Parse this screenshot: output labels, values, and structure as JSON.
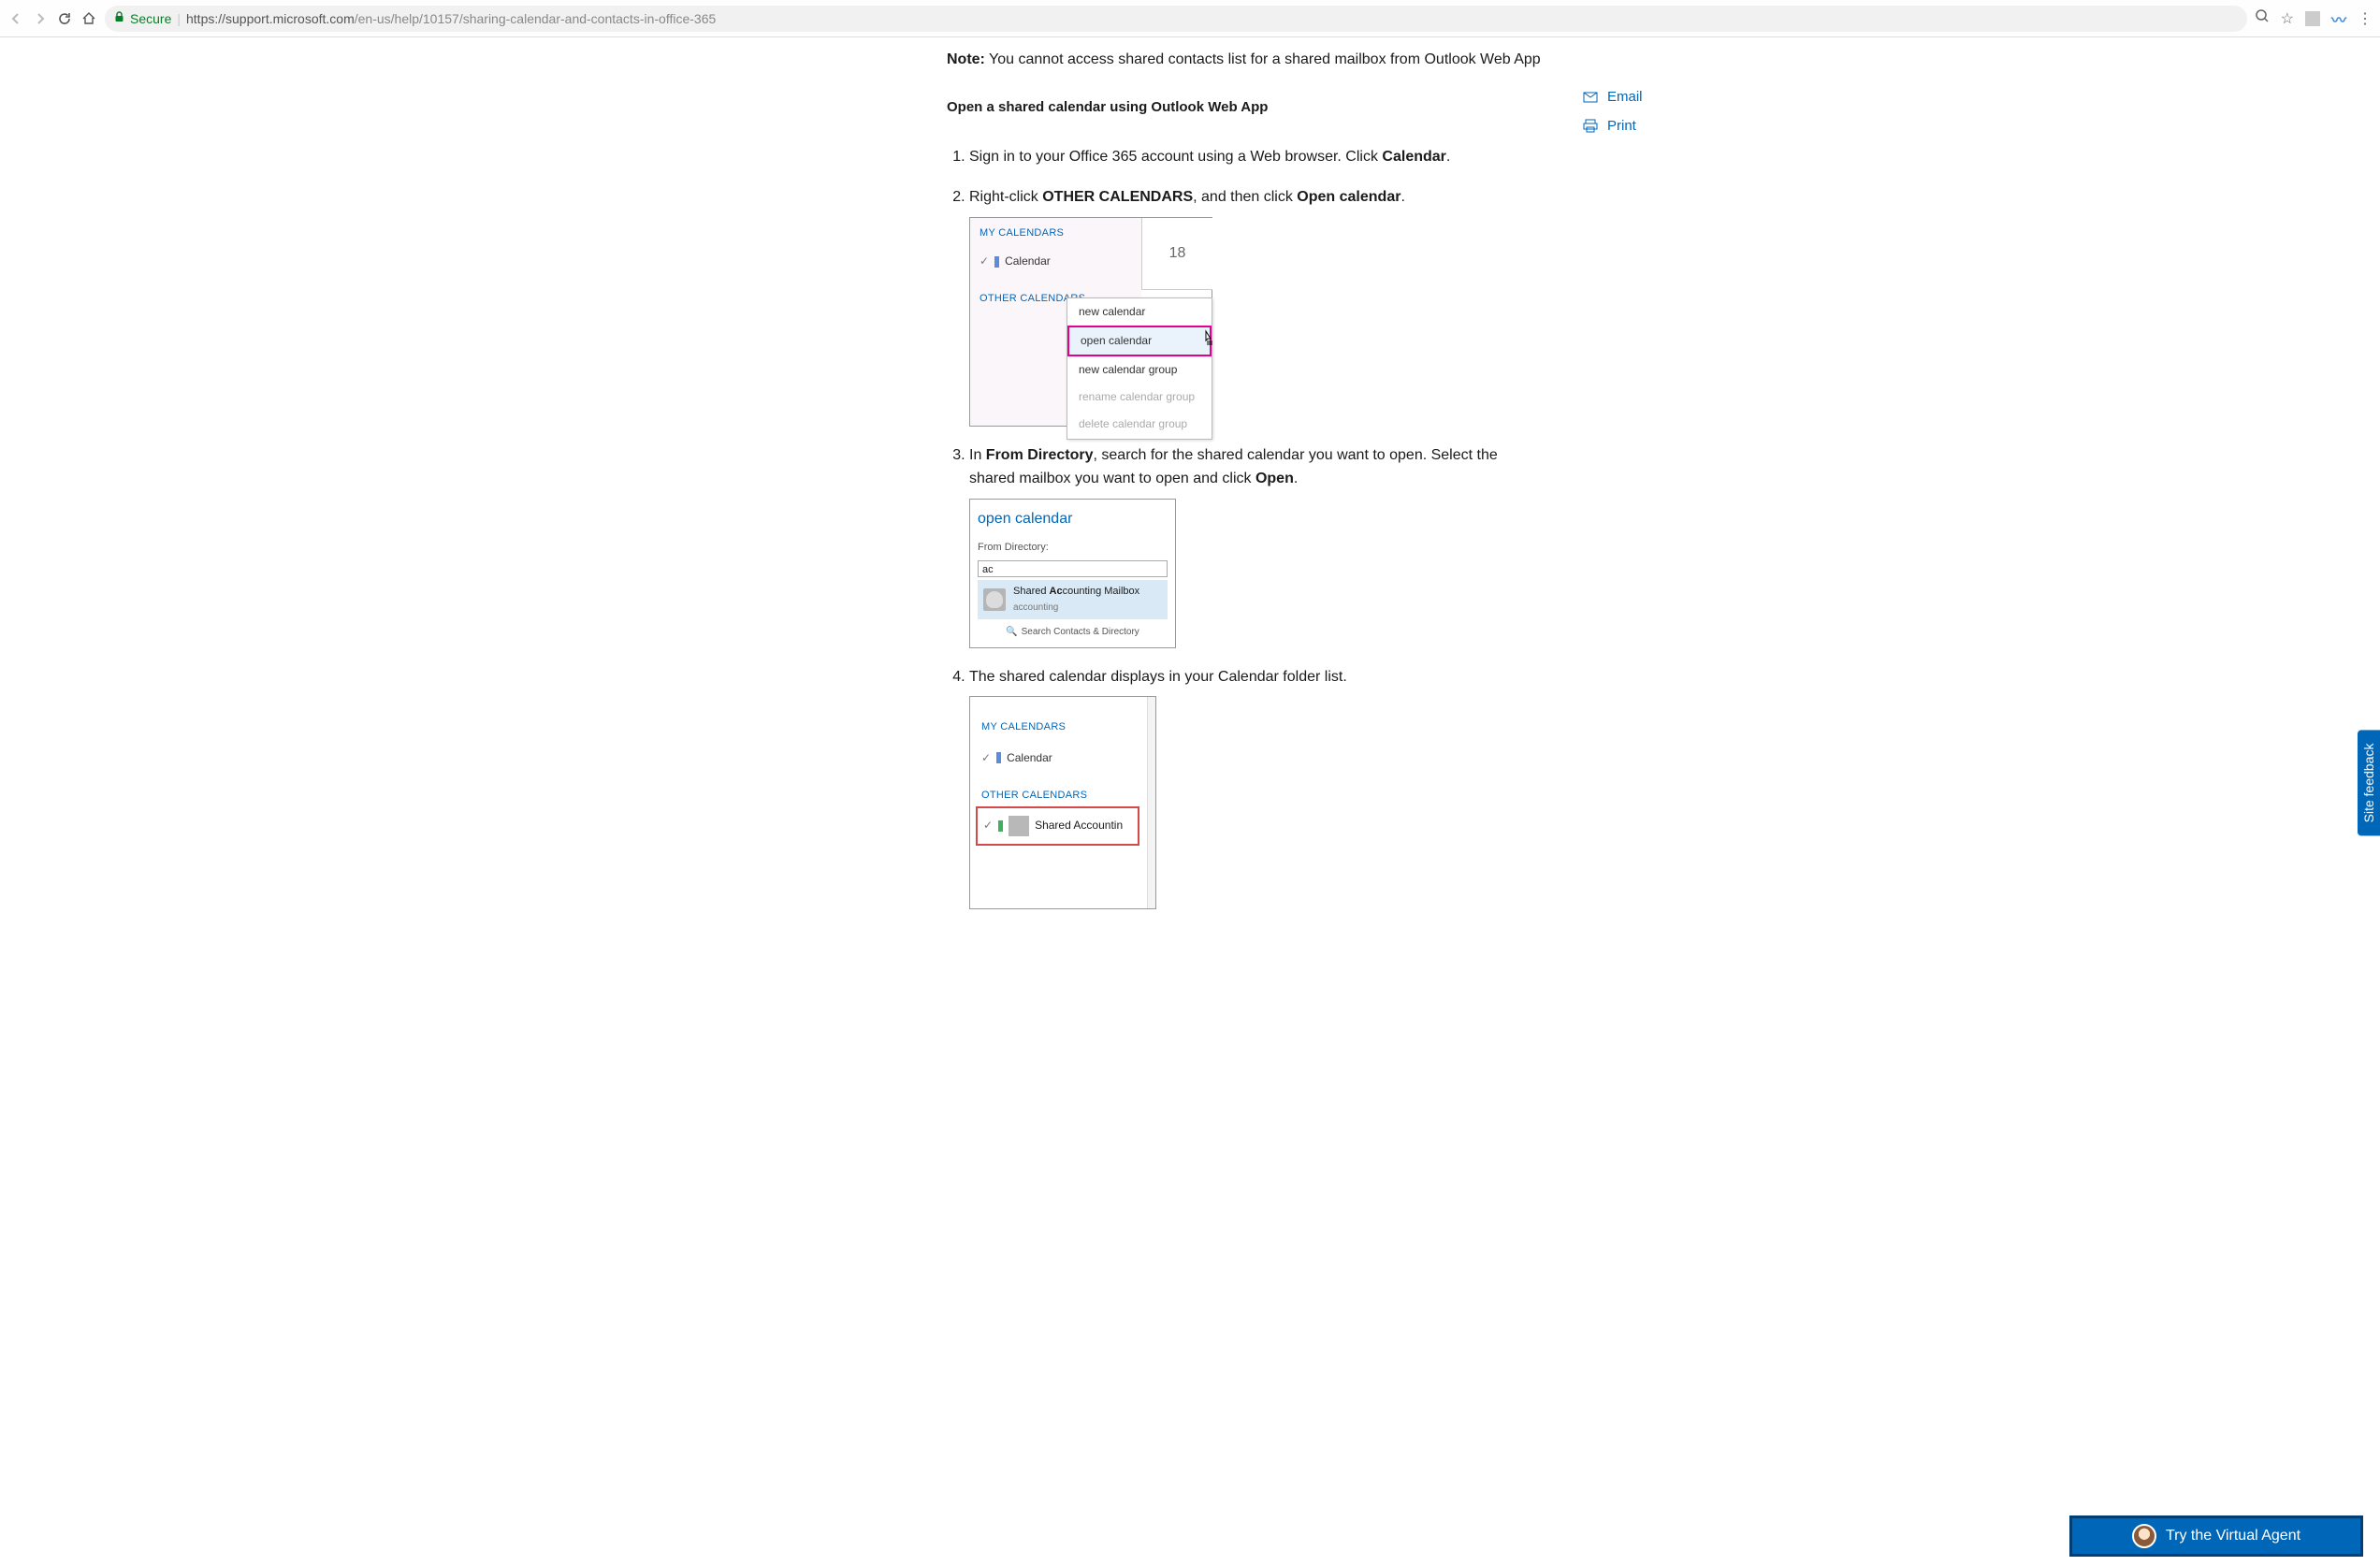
{
  "browser": {
    "secure_label": "Secure",
    "url_host": "https://support.microsoft.com",
    "url_path": "/en-us/help/10157/sharing-calendar-and-contacts-in-office-365"
  },
  "note": {
    "label": "Note:",
    "text": " You cannot access shared contacts list for a shared mailbox from Outlook Web App"
  },
  "section_heading": "Open a shared calendar using Outlook Web App",
  "steps": {
    "s1_a": "Sign in to your Office 365 account using a Web browser. Click ",
    "s1_b": "Calendar",
    "s1_c": ".",
    "s2_a": "Right-click ",
    "s2_b": "OTHER CALENDARS",
    "s2_c": ", and then click ",
    "s2_d": "Open calendar",
    "s2_e": ".",
    "s3_a": "In ",
    "s3_b": "From Directory",
    "s3_c": ", search for the shared calendar you want to open. Select the shared mailbox you want to open and click ",
    "s3_d": "Open",
    "s3_e": ".",
    "s4": "The shared calendar displays in your Calendar folder list."
  },
  "ss1": {
    "my_calendars": "MY CALENDARS",
    "calendar": "Calendar",
    "other_calendars": "OTHER CALENDARS",
    "day_number": "18",
    "menu": {
      "new_calendar": "new calendar",
      "open_calendar": "open calendar",
      "new_calendar_group": "new calendar group",
      "rename_calendar_group": "rename calendar group",
      "delete_calendar_group": "delete calendar group"
    }
  },
  "ss2": {
    "title": "open calendar",
    "from_directory": "From Directory:",
    "input_value": "ac",
    "result_main_a": "Shared ",
    "result_main_bold": "Ac",
    "result_main_b": "counting Mailbox",
    "result_sub": "accounting",
    "search_contacts": "Search Contacts & Directory"
  },
  "ss3": {
    "my_calendars": "MY CALENDARS",
    "calendar": "Calendar",
    "other_calendars": "OTHER CALENDARS",
    "shared_name": "Shared Accountin"
  },
  "side": {
    "email": "Email",
    "print": "Print"
  },
  "feedback_tab": "Site feedback",
  "virtual_agent": "Try the Virtual Agent"
}
